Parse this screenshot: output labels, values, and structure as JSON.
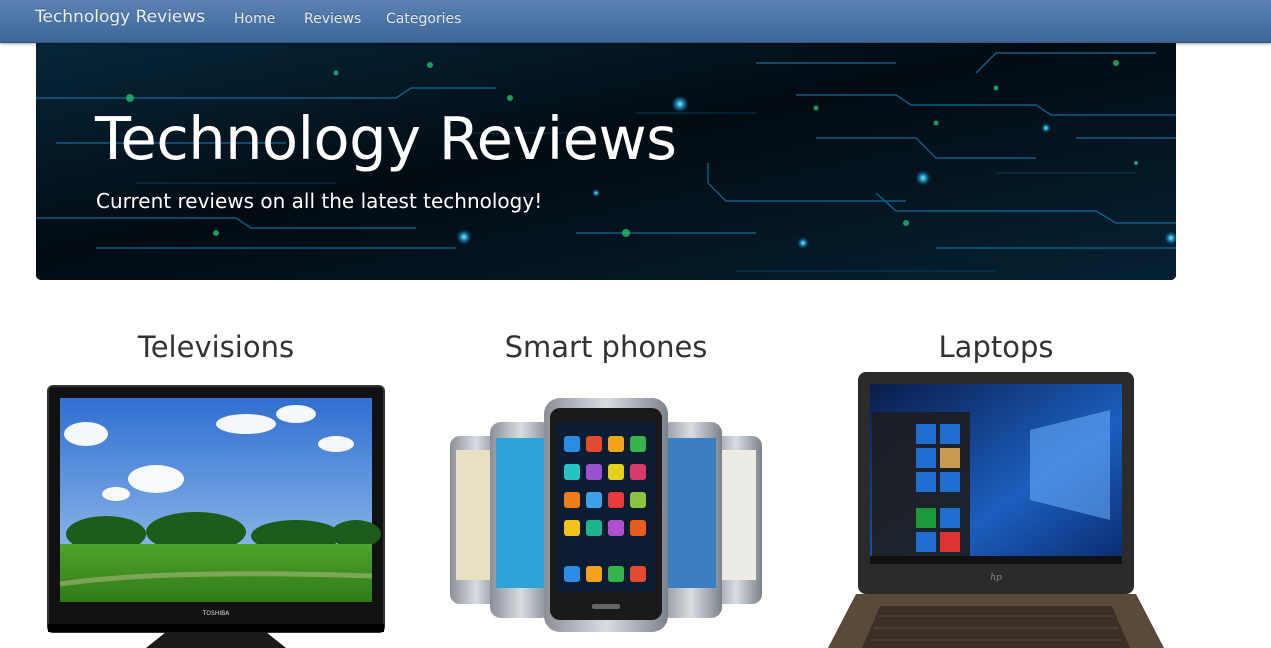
{
  "navbar": {
    "brand": "Technology Reviews",
    "links": [
      {
        "label": "Home"
      },
      {
        "label": "Reviews"
      },
      {
        "label": "Categories"
      }
    ],
    "colors": {
      "bar": "#4a73a5",
      "text": "#e9eef5"
    }
  },
  "hero": {
    "title": "Technology Reviews",
    "subtitle": "Current reviews on all the latest technology!",
    "background": "circuit-board-pattern",
    "colors": {
      "base": "#03101a",
      "trace": "#1a9ad6",
      "glow": "#36c2ff"
    }
  },
  "categories": [
    {
      "title": "Televisions",
      "image": "television-image",
      "tv_brand": "TOSHIBA"
    },
    {
      "title": "Smart phones",
      "image": "smartphones-image"
    },
    {
      "title": "Laptops",
      "image": "laptop-image",
      "laptop_logo": "hp"
    }
  ]
}
